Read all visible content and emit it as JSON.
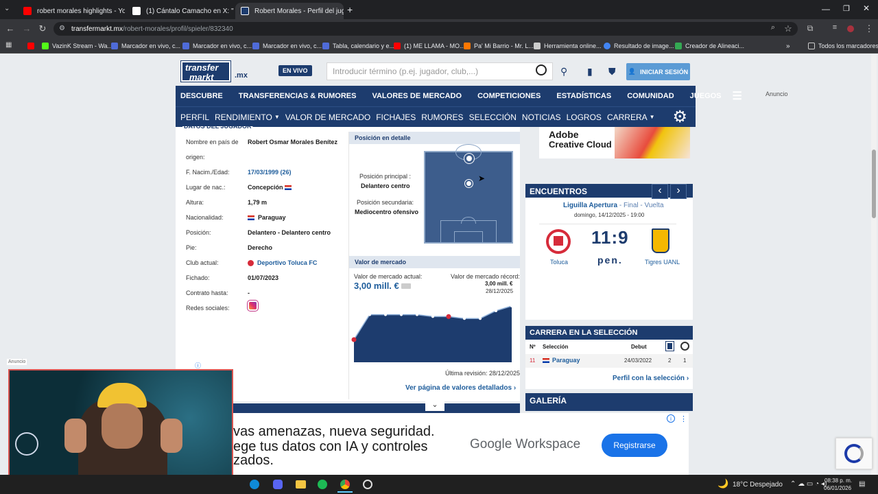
{
  "browser": {
    "tabs": [
      {
        "title": "robert morales highlights - You",
        "icon": "youtube-icon",
        "color": "#ff0000"
      },
      {
        "title": "(1) Cántalo Camacho en X: \"Op",
        "icon": "x-icon",
        "color": "#ffffff"
      },
      {
        "title": "Robert Morales - Perfil del jug",
        "icon": "transfermarkt-icon",
        "color": "#1d3c6e"
      }
    ],
    "url_host": "transfermarkt.mx",
    "url_path": "/robert-morales/profil/spieler/832340",
    "bookmarks": [
      {
        "label": "VazinK Stream - Wa...",
        "color": "#53fc18"
      },
      {
        "label": "Marcador en vivo, c...",
        "color": "#4f6bd8"
      },
      {
        "label": "Marcador en vivo, c...",
        "color": "#4f6bd8"
      },
      {
        "label": "Marcador en vivo, c...",
        "color": "#4f6bd8"
      },
      {
        "label": "Tabla, calendario y e...",
        "color": "#4f6bd8"
      },
      {
        "label": "(1) ME LLAMA - MO...",
        "color": "#ff0000"
      },
      {
        "label": "Pa' Mi Barrio - Mr. L...",
        "color": "#ff7700"
      },
      {
        "label": "Herramienta online...",
        "color": "#cccccc"
      },
      {
        "label": "Resultado de image...",
        "color": "#4285f4"
      },
      {
        "label": "Creador de Alineaci...",
        "color": "#34a853"
      }
    ],
    "all_bookmarks": "Todos los marcadores"
  },
  "header": {
    "logo_line1": "transfer",
    "logo_line2": "markt",
    "tld": ".mx",
    "live": "EN VIVO",
    "search_placeholder": "Introducir término (p.ej. jugador, club,...)",
    "login": "INICIAR SESIÓN",
    "ad_label": "Anuncio"
  },
  "main_nav": [
    "DESCUBRE",
    "TRANSFERENCIAS & RUMORES",
    "VALORES DE MERCADO",
    "COMPETICIONES",
    "ESTADÍSTICAS",
    "COMUNIDAD",
    "JUEGOS"
  ],
  "sub_nav": [
    "PERFIL",
    "RENDIMIENTO",
    "VALOR DE MERCADO",
    "FICHAJES",
    "RUMORES",
    "SELECCIÓN",
    "NOTICIAS",
    "LOGROS",
    "CARRERA"
  ],
  "player": {
    "section_title": "DATOS DEL JUGADOR",
    "rows": [
      {
        "label": "Nombre en país de",
        "value": "Robert Osmar Morales Benítez"
      },
      {
        "label": "origen:",
        "value": ""
      },
      {
        "label": "F. Nacim./Edad:",
        "value": "17/03/1999 (26)"
      },
      {
        "label": "Lugar de nac.:",
        "value": "Concepción"
      },
      {
        "label": "Altura:",
        "value": "1,79 m"
      },
      {
        "label": "Nacionalidad:",
        "value": "Paraguay"
      },
      {
        "label": "Posición:",
        "value": "Delantero - Delantero centro"
      },
      {
        "label": "Pie:",
        "value": "Derecho"
      },
      {
        "label": "Club actual:",
        "value": "Deportivo Toluca FC"
      },
      {
        "label": "Fichado:",
        "value": "01/07/2023"
      },
      {
        "label": "Contrato hasta:",
        "value": "-"
      },
      {
        "label": "Redes sociales:",
        "value": ""
      }
    ]
  },
  "position": {
    "title": "Posición en detalle",
    "main_label": "Posición principal :",
    "main_value": "Delantero centro",
    "secondary_label": "Posición secundaria:",
    "secondary_value": "Mediocentro ofensivo"
  },
  "market": {
    "title": "Valor de mercado",
    "current_label": "Valor de mercado actual:",
    "current_value": "3,00 mill. €",
    "record_label": "Valor de mercado récord:",
    "record_value": "3,00 mill. €",
    "record_date": "28/12/2025",
    "revision": "Última revisión: 28/12/2025",
    "details_link": "Ver página de valores detallados",
    "chart_values": [
      0.3,
      0.82,
      0.82,
      0.82,
      0.82,
      0.78,
      0.78,
      0.74,
      0.74,
      0.9,
      1.0
    ]
  },
  "encounters": {
    "title": "ENCUENTROS",
    "competition": "Liguilla Apertura",
    "stage": " - Final - Vuelta",
    "date": "domingo, 14/12/2025 - 19:00",
    "home": "Toluca",
    "away": "Tigres UANL",
    "score": "11:9",
    "note": "pen."
  },
  "national": {
    "title": "CARRERA EN LA SELECCIÓN",
    "headers": [
      "Nº",
      "Selección",
      "Debut"
    ],
    "row": {
      "number": "11",
      "team": "Paraguay",
      "debut": "24/03/2022",
      "matches": "2",
      "goals": "1"
    },
    "link": "Perfil con la selección"
  },
  "gallery_title": "GALERÍA",
  "ad_top": {
    "line1": "Adobe",
    "line2": "Creative Cloud"
  },
  "ad_bottom": {
    "text1": "vas amenazas, nueva seguridad.",
    "text2": "ege tus datos con IA y controles",
    "text3": "zados.",
    "brand": "Google Workspace",
    "cta": "Registrarse"
  },
  "webcam_ad_label": "Anuncio",
  "taskbar": {
    "weather": "18°C Despejado",
    "time": "08:38 p. m.",
    "date": "06/01/2026"
  },
  "colors": {
    "brand": "#1d3c6e",
    "accent": "#5b9bd5",
    "link": "#1d5c9b"
  }
}
